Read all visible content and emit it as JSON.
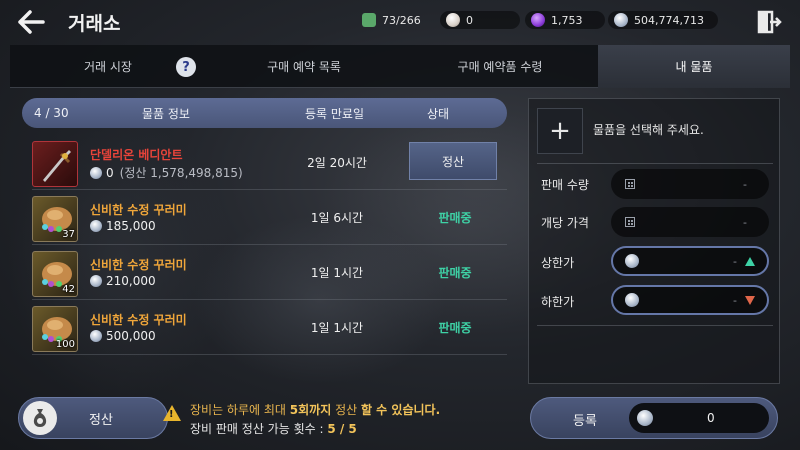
{
  "header": {
    "title": "거래소",
    "currencies": [
      {
        "icon": "stamina-icon",
        "value": "73/266",
        "color": "#5aa86a"
      },
      {
        "icon": "pearl-icon",
        "value": "0",
        "color": "#d8d0c8"
      },
      {
        "icon": "purple-gem-icon",
        "value": "1,753",
        "color": "#8a3ad8"
      },
      {
        "icon": "silver-coin-icon",
        "value": "504,774,713",
        "color": "#a9b6c9"
      }
    ]
  },
  "tabs": [
    {
      "label": "거래 시장",
      "active": false
    },
    {
      "label": "구매 예약 목록",
      "active": false
    },
    {
      "label": "구매 예약품 수령",
      "active": false
    },
    {
      "label": "내 물품",
      "active": true
    }
  ],
  "list": {
    "count": "4 / 30",
    "col_info": "물품 정보",
    "col_date": "등록 만료일",
    "col_status": "상태",
    "rows": [
      {
        "name": "단델리온 베디안트",
        "name_color": "#e8443a",
        "price": "0",
        "sub": "(정산 1,578,498,815)",
        "date": "2일 20시간",
        "status": "정산",
        "is_button": true,
        "qty": ""
      },
      {
        "name": "신비한 수정 꾸러미",
        "name_color": "#f0a63a",
        "price": "185,000",
        "sub": "",
        "date": "1일 6시간",
        "status": "판매중",
        "is_button": false,
        "qty": "37"
      },
      {
        "name": "신비한 수정 꾸러미",
        "name_color": "#f0a63a",
        "price": "210,000",
        "sub": "",
        "date": "1일 1시간",
        "status": "판매중",
        "is_button": false,
        "qty": "42"
      },
      {
        "name": "신비한 수정 꾸러미",
        "name_color": "#f0a63a",
        "price": "500,000",
        "sub": "",
        "date": "1일 1시간",
        "status": "판매중",
        "is_button": false,
        "qty": "100"
      }
    ]
  },
  "sell_panel": {
    "hint": "물품을 선택해 주세요.",
    "sell_qty_label": "판매 수량",
    "unit_price_label": "개당 가격",
    "upper_label": "상한가",
    "lower_label": "하한가",
    "empty_value": "-"
  },
  "footer": {
    "settle_label": "정산",
    "warn_line1_a": "장비는 하루에 최대 ",
    "warn_line1_b": "5회까지",
    "warn_line1_c": " 정산 ",
    "warn_line1_d": "할 수 있습니다.",
    "warn_line2_a": "장비 판매 정산 가능 횟수 : ",
    "warn_line2_b": "5 / 5",
    "register_label": "등록",
    "register_amount": "0"
  }
}
